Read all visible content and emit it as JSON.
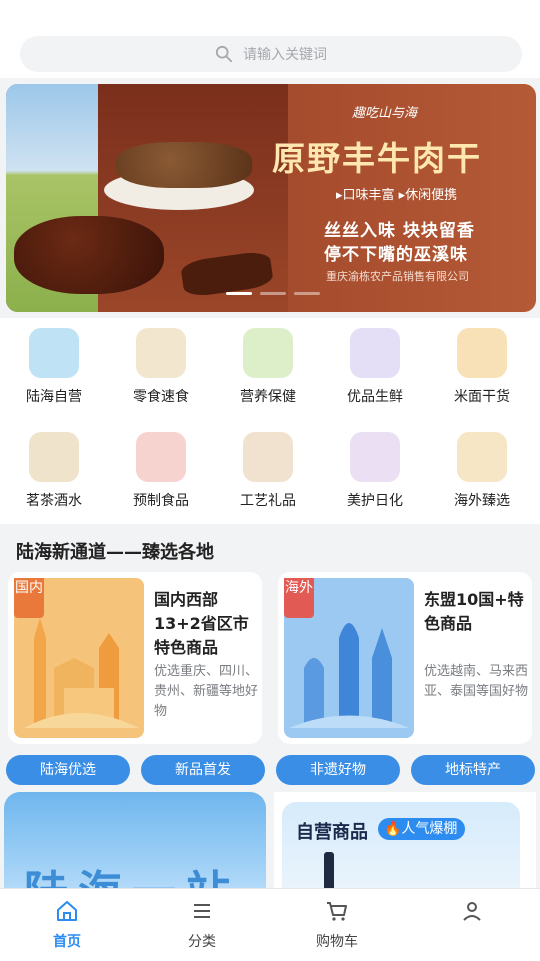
{
  "search": {
    "placeholder": "请输入关键词",
    "icon": "search-icon"
  },
  "banner": {
    "brand": "趣吃山与海",
    "title": "原野丰牛肉干",
    "tags": "▸口味丰富 ▸休闲便携",
    "slogan_line1": "丝丝入味 块块留香",
    "slogan_line2": "停不下嘴的巫溪味",
    "company": "重庆渝栋农产品销售有限公司",
    "slides": 3,
    "active_slide": 1
  },
  "categories": [
    {
      "label": "陆海自营",
      "color": "#bfe3f5"
    },
    {
      "label": "零食速食",
      "color": "#f3e6cf"
    },
    {
      "label": "营养保健",
      "color": "#dcefc8"
    },
    {
      "label": "优品生鲜",
      "color": "#e4def6"
    },
    {
      "label": "米面干货",
      "color": "#f8e1b6"
    },
    {
      "label": "茗茶酒水",
      "color": "#efe3cc"
    },
    {
      "label": "预制食品",
      "color": "#f7d3cf"
    },
    {
      "label": "工艺礼品",
      "color": "#f1e2cf"
    },
    {
      "label": "美护日化",
      "color": "#eadff3"
    },
    {
      "label": "海外臻选",
      "color": "#f6e6c6"
    }
  ],
  "section": {
    "heading": "陆海新通道——臻选各地",
    "cards": [
      {
        "flag": "国内",
        "title": "国内西部13+2省区市特色商品",
        "desc": "优选重庆、四川、贵州、新疆等地好物",
        "flag_color": "#e8793a",
        "pic_color": "#f6c37a"
      },
      {
        "flag": "海外",
        "title": "东盟10国+特色商品",
        "desc": "优选越南、马来西亚、泰国等国好物",
        "flag_color": "#e25a54",
        "pic_color": "#9cc9f2"
      }
    ]
  },
  "pills": [
    {
      "label": "陆海优选"
    },
    {
      "label": "新品首发"
    },
    {
      "label": "非遗好物"
    },
    {
      "label": "地标特产"
    }
  ],
  "promo": {
    "left_text": "陆海一站",
    "right_title": "自营商品",
    "right_badge": "🔥人气爆棚"
  },
  "tabbar": {
    "items": [
      {
        "label": "首页",
        "icon": "home-icon",
        "active": true
      },
      {
        "label": "分类",
        "icon": "list-icon",
        "active": false
      },
      {
        "label": "购物车",
        "icon": "cart-icon",
        "active": false
      },
      {
        "label": "",
        "icon": "user-icon",
        "active": false
      }
    ]
  },
  "colors": {
    "accent": "#2d8cf0",
    "pill": "#3a8ee6"
  }
}
